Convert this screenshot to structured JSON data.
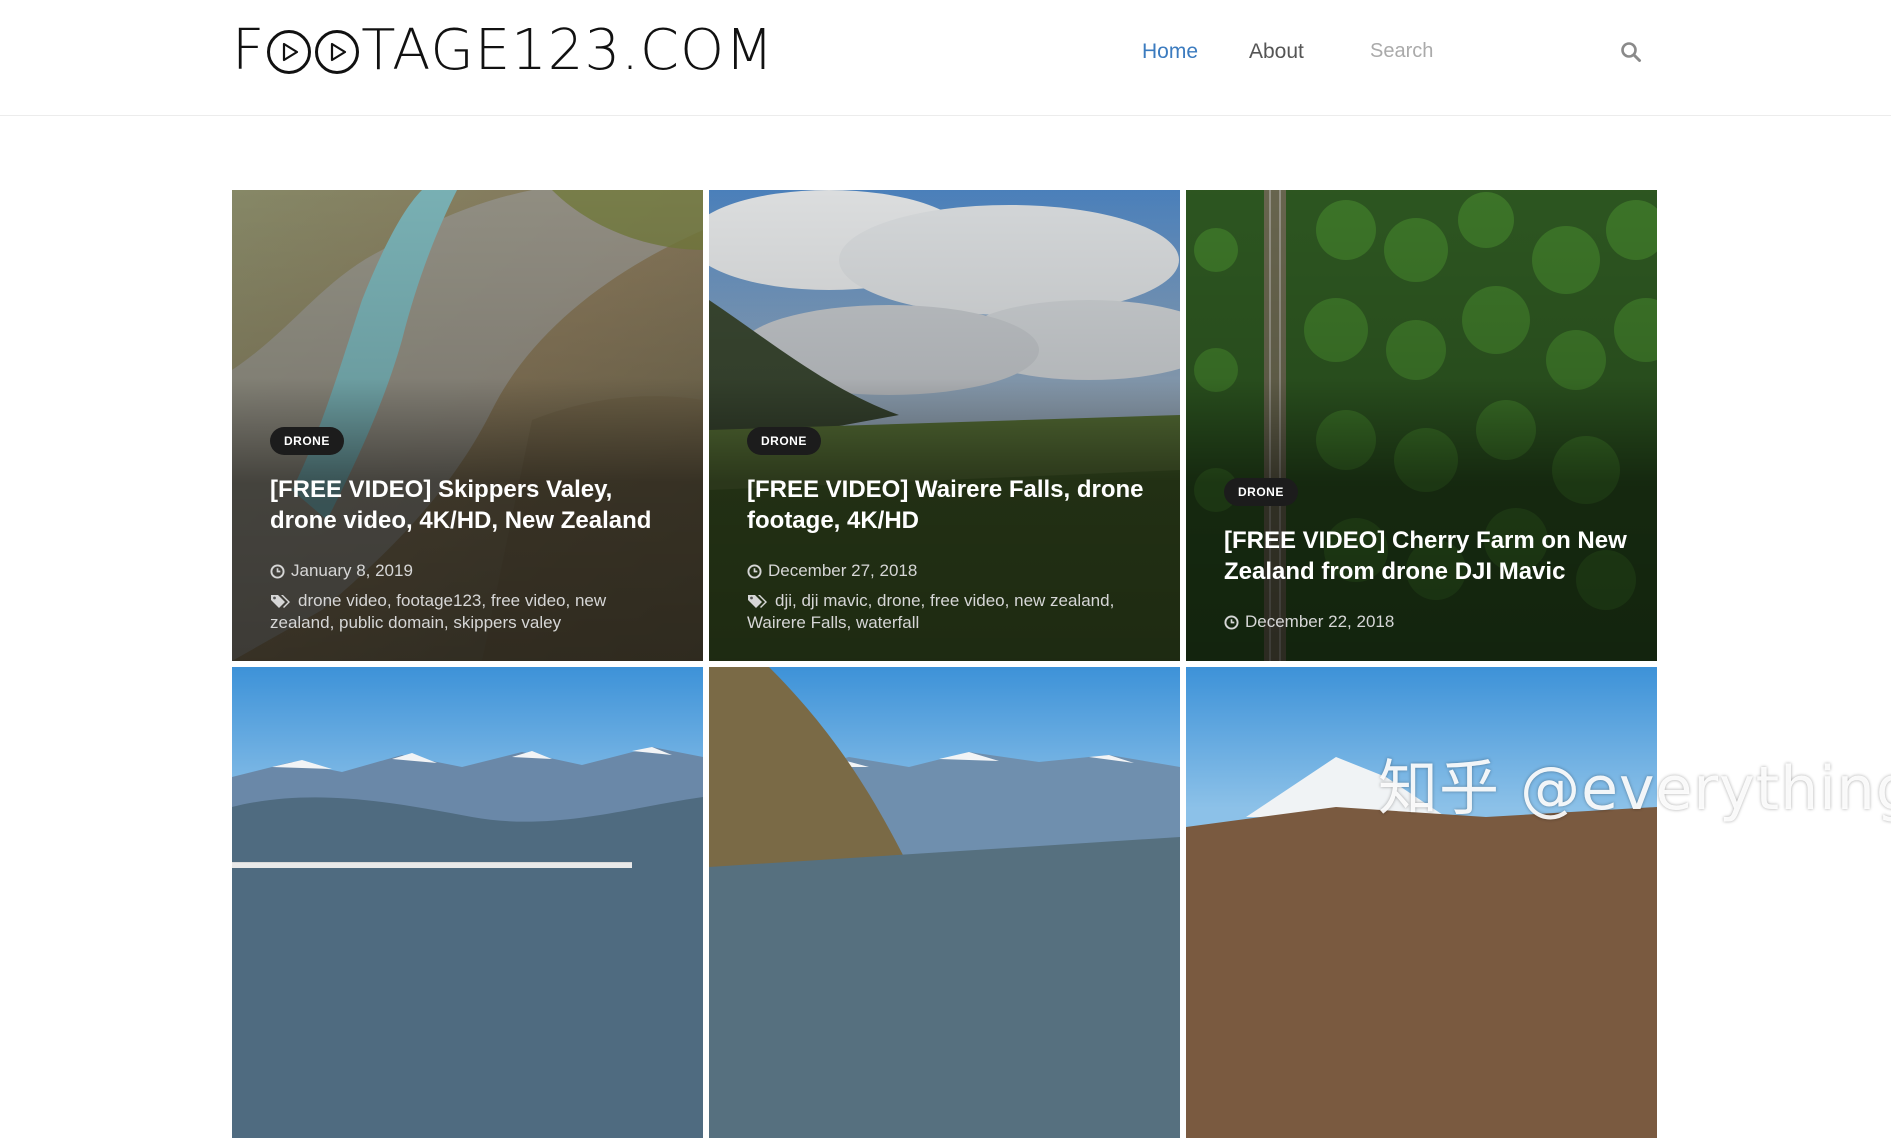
{
  "header": {
    "logo_text": "FOOTAGE123.COM",
    "nav": [
      {
        "label": "Home",
        "active": true
      },
      {
        "label": "About",
        "active": false
      }
    ],
    "search": {
      "placeholder": "Search",
      "value": ""
    }
  },
  "posts": [
    {
      "category": "DRONE",
      "title": "[FREE VIDEO] Skippers Valey, drone video, 4K/HD, New Zealand",
      "date": "January 8, 2019",
      "tags": [
        "drone video",
        "footage123",
        "free video",
        "new zealand",
        "public domain",
        "skippers valey"
      ]
    },
    {
      "category": "DRONE",
      "title": "[FREE VIDEO] Wairere Falls, drone footage, 4K/HD",
      "date": "December 27, 2018",
      "tags": [
        "dji",
        "dji mavic",
        "drone",
        "free video",
        "new zealand",
        "Wairere Falls",
        "waterfall"
      ]
    },
    {
      "category": "DRONE",
      "title": "[FREE VIDEO] Cherry Farm on New Zealand from drone DJI Mavic",
      "date": "December 22, 2018",
      "tags": []
    }
  ],
  "watermark": "知乎 @everything",
  "colors": {
    "accent": "#3b7bbf",
    "badge_bg": "#1c1c1c"
  },
  "icons": {
    "search": "search-icon",
    "date": "clock-icon",
    "tags": "tags-icon"
  }
}
